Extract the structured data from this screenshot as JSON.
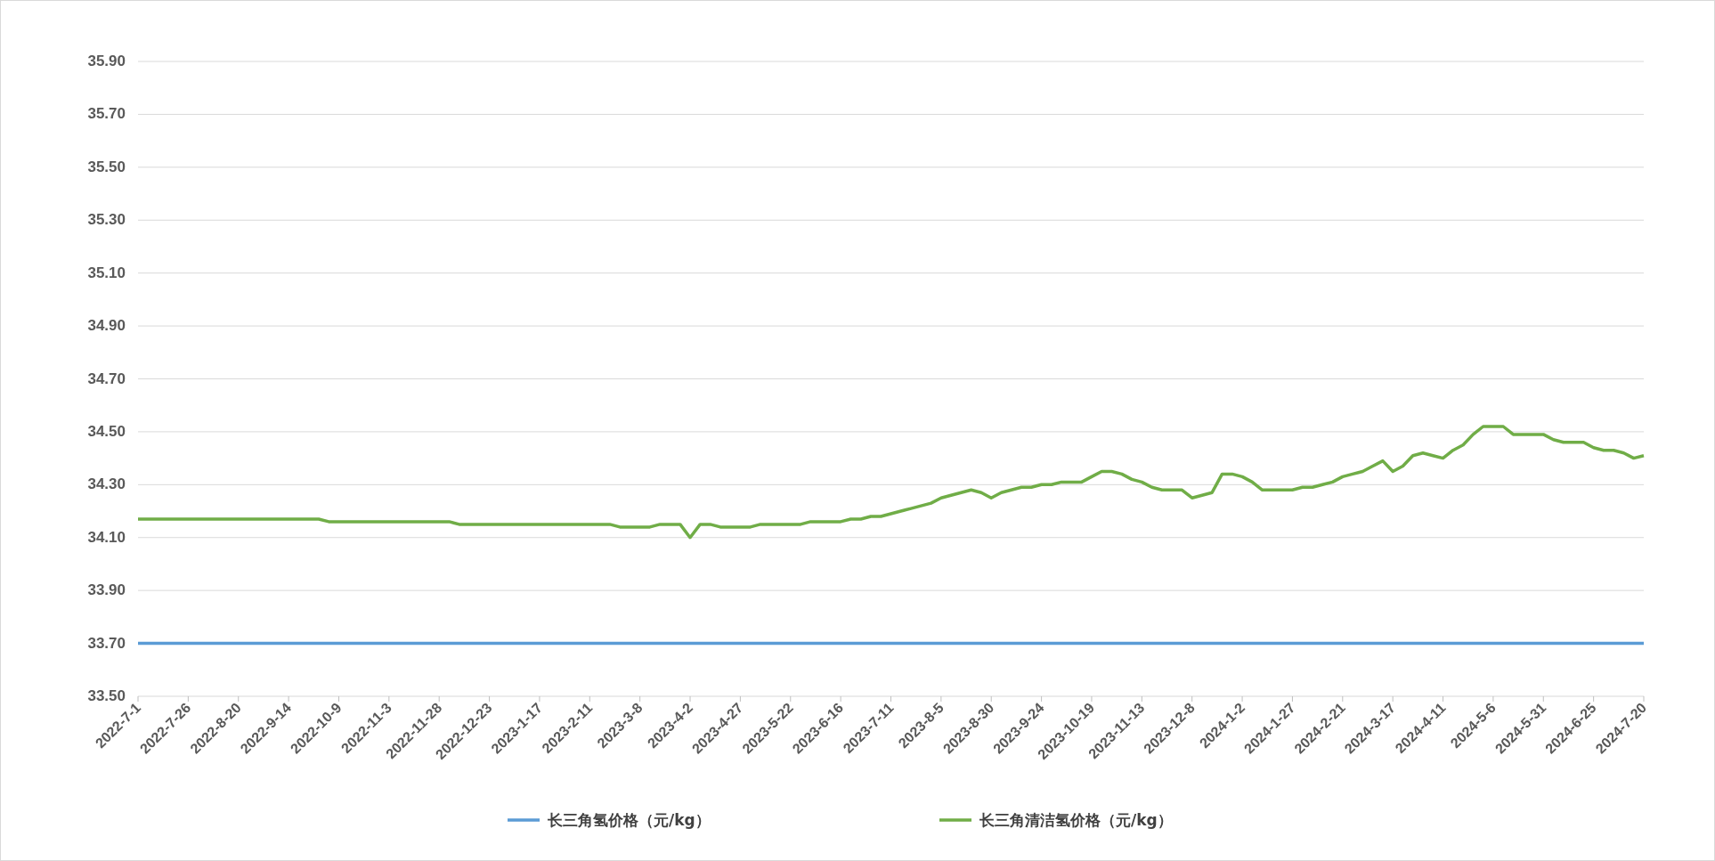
{
  "chart_data": {
    "type": "line",
    "grid": true,
    "legend": "bottom",
    "categories": [
      "2022-7-1",
      null,
      null,
      null,
      null,
      "2022-7-26",
      null,
      null,
      null,
      null,
      "2022-8-20",
      null,
      null,
      null,
      null,
      "2022-9-14",
      null,
      null,
      null,
      null,
      "2022-10-9",
      null,
      null,
      null,
      null,
      "2022-11-3",
      null,
      null,
      null,
      null,
      "2022-11-28",
      null,
      null,
      null,
      null,
      "2022-12-23",
      null,
      null,
      null,
      null,
      "2023-1-17",
      null,
      null,
      null,
      null,
      "2023-2-11",
      null,
      null,
      null,
      null,
      "2023-3-8",
      null,
      null,
      null,
      null,
      "2023-4-2",
      null,
      null,
      null,
      null,
      "2023-4-27",
      null,
      null,
      null,
      null,
      "2023-5-22",
      null,
      null,
      null,
      null,
      "2023-6-16",
      null,
      null,
      null,
      null,
      "2023-7-11",
      null,
      null,
      null,
      null,
      "2023-8-5",
      null,
      null,
      null,
      null,
      "2023-8-30",
      null,
      null,
      null,
      null,
      "2023-9-24",
      null,
      null,
      null,
      null,
      "2023-10-19",
      null,
      null,
      null,
      null,
      "2023-11-13",
      null,
      null,
      null,
      null,
      "2023-12-8",
      null,
      null,
      null,
      null,
      "2024-1-2",
      null,
      null,
      null,
      null,
      "2024-1-27",
      null,
      null,
      null,
      null,
      "2024-2-21",
      null,
      null,
      null,
      null,
      "2024-3-17",
      null,
      null,
      null,
      null,
      "2024-4-11",
      null,
      null,
      null,
      null,
      "2024-5-6",
      null,
      null,
      null,
      null,
      "2024-5-31",
      null,
      null,
      null,
      null,
      "2024-6-25",
      null,
      null,
      null,
      null,
      "2024-7-20"
    ],
    "ylim": [
      33.5,
      35.9
    ],
    "yticks": [
      {
        "value": 33.5,
        "label": "33.50"
      },
      {
        "value": 33.7,
        "label": "33.70"
      },
      {
        "value": 33.9,
        "label": "33.90"
      },
      {
        "value": 34.1,
        "label": "34.10"
      },
      {
        "value": 34.3,
        "label": "34.30"
      },
      {
        "value": 34.5,
        "label": "34.50"
      },
      {
        "value": 34.7,
        "label": "34.70"
      },
      {
        "value": 34.9,
        "label": "34.90"
      },
      {
        "value": 35.1,
        "label": "35.10"
      },
      {
        "value": 35.3,
        "label": "35.30"
      },
      {
        "value": 35.5,
        "label": "35.50"
      },
      {
        "value": 35.7,
        "label": "35.70"
      },
      {
        "value": 35.9,
        "label": "35.90"
      }
    ],
    "series": [
      {
        "name": "长三角氢价格（元/kg）",
        "color": "#5b9bd5",
        "values": [
          33.7,
          33.7,
          33.7,
          33.7,
          33.7,
          33.7,
          33.7,
          33.7,
          33.7,
          33.7,
          33.7,
          33.7,
          33.7,
          33.7,
          33.7,
          33.7,
          33.7,
          33.7,
          33.7,
          33.7,
          33.7,
          33.7,
          33.7,
          33.7,
          33.7,
          33.7,
          33.7,
          33.7,
          33.7,
          33.7,
          33.7,
          33.7,
          33.7,
          33.7,
          33.7,
          33.7,
          33.7,
          33.7,
          33.7,
          33.7,
          33.7,
          33.7,
          33.7,
          33.7,
          33.7,
          33.7,
          33.7,
          33.7,
          33.7,
          33.7,
          33.7,
          33.7,
          33.7,
          33.7,
          33.7,
          33.7,
          33.7,
          33.7,
          33.7,
          33.7,
          33.7,
          33.7,
          33.7,
          33.7,
          33.7,
          33.7,
          33.7,
          33.7,
          33.7,
          33.7,
          33.7,
          33.7,
          33.7,
          33.7,
          33.7,
          33.7,
          33.7,
          33.7,
          33.7,
          33.7,
          33.7,
          33.7,
          33.7,
          33.7,
          33.7,
          33.7,
          33.7,
          33.7,
          33.7,
          33.7,
          33.7,
          33.7,
          33.7,
          33.7,
          33.7,
          33.7,
          33.7,
          33.7,
          33.7,
          33.7,
          33.7,
          33.7,
          33.7,
          33.7,
          33.7,
          33.7,
          33.7,
          33.7,
          33.7,
          33.7,
          33.7,
          33.7,
          33.7,
          33.7,
          33.7,
          33.7,
          33.7,
          33.7,
          33.7,
          33.7,
          33.7,
          33.7,
          33.7,
          33.7,
          33.7,
          33.7,
          33.7,
          33.7,
          33.7,
          33.7,
          33.7,
          33.7,
          33.7,
          33.7,
          33.7,
          33.7,
          33.7,
          33.7,
          33.7,
          33.7,
          33.7,
          33.7,
          33.7,
          33.7,
          33.7,
          33.7,
          33.7,
          33.7,
          33.7,
          33.7,
          33.7
        ]
      },
      {
        "name": "长三角清洁氢价格（元/kg）",
        "color": "#70ad47",
        "values": [
          34.17,
          34.17,
          34.17,
          34.17,
          34.17,
          34.17,
          34.17,
          34.17,
          34.17,
          34.17,
          34.17,
          34.17,
          34.17,
          34.17,
          34.17,
          34.17,
          34.17,
          34.17,
          34.17,
          34.16,
          34.16,
          34.16,
          34.16,
          34.16,
          34.16,
          34.16,
          34.16,
          34.16,
          34.16,
          34.16,
          34.16,
          34.16,
          34.15,
          34.15,
          34.15,
          34.15,
          34.15,
          34.15,
          34.15,
          34.15,
          34.15,
          34.15,
          34.15,
          34.15,
          34.15,
          34.15,
          34.15,
          34.15,
          34.14,
          34.14,
          34.14,
          34.14,
          34.15,
          34.15,
          34.15,
          34.1,
          34.15,
          34.15,
          34.14,
          34.14,
          34.14,
          34.14,
          34.15,
          34.15,
          34.15,
          34.15,
          34.15,
          34.16,
          34.16,
          34.16,
          34.16,
          34.17,
          34.17,
          34.18,
          34.18,
          34.19,
          34.2,
          34.21,
          34.22,
          34.23,
          34.25,
          34.26,
          34.27,
          34.28,
          34.27,
          34.25,
          34.27,
          34.28,
          34.29,
          34.29,
          34.3,
          34.3,
          34.31,
          34.31,
          34.31,
          34.33,
          34.35,
          34.35,
          34.34,
          34.32,
          34.31,
          34.29,
          34.28,
          34.28,
          34.28,
          34.25,
          34.26,
          34.27,
          34.34,
          34.34,
          34.33,
          34.31,
          34.28,
          34.28,
          34.28,
          34.28,
          34.29,
          34.29,
          34.3,
          34.31,
          34.33,
          34.34,
          34.35,
          34.37,
          34.39,
          34.35,
          34.37,
          34.41,
          34.42,
          34.41,
          34.4,
          34.43,
          34.45,
          34.49,
          34.52,
          34.52,
          34.52,
          34.49,
          34.49,
          34.49,
          34.49,
          34.47,
          34.46,
          34.46,
          34.46,
          34.44,
          34.43,
          34.43,
          34.42,
          34.4,
          34.41
        ]
      }
    ]
  }
}
